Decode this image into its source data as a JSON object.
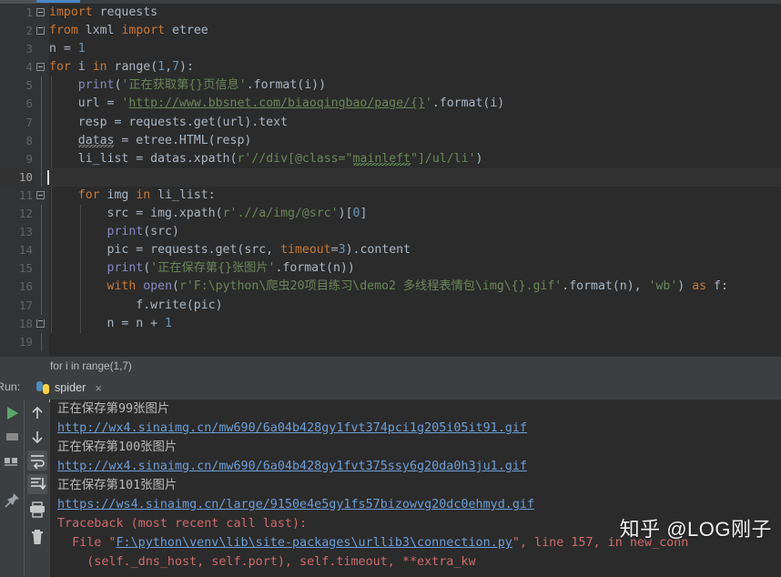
{
  "window": {
    "theme_bg": "#2b2b2b",
    "panel_bg": "#3c3f41",
    "accent": "#4a88c7"
  },
  "editor": {
    "current_line": 10,
    "lines": [
      {
        "n": "1",
        "text": "import requests"
      },
      {
        "n": "2",
        "text": "from lxml import etree"
      },
      {
        "n": "3",
        "text": "n = 1"
      },
      {
        "n": "4",
        "text": "for i in range(1,7):"
      },
      {
        "n": "5",
        "text": "    print('正在获取第{}页信息'.format(i))"
      },
      {
        "n": "6",
        "text": "    url = 'http://www.bbsnet.com/biaoqingbao/page/{}'.format(i)"
      },
      {
        "n": "7",
        "text": "    resp = requests.get(url).text"
      },
      {
        "n": "8",
        "text": "    datas = etree.HTML(resp)"
      },
      {
        "n": "9",
        "text": "    li_list = datas.xpath(r'//div[@class=\"mainleft\"]/ul/li')"
      },
      {
        "n": "10",
        "text": ""
      },
      {
        "n": "11",
        "text": "    for img in li_list:"
      },
      {
        "n": "12",
        "text": "        src = img.xpath(r'.//a/img/@src')[0]"
      },
      {
        "n": "13",
        "text": "        print(src)"
      },
      {
        "n": "14",
        "text": "        pic = requests.get(src, timeout=3).content"
      },
      {
        "n": "15",
        "text": "        print('正在保存第{}张图片'.format(n))"
      },
      {
        "n": "16",
        "text": "        with open(r'F:\\python\\爬虫20项目练习\\demo2 多线程表情包\\img\\{}.gif'.format(n), 'wb') as f:"
      },
      {
        "n": "17",
        "text": "            f.write(pic)"
      },
      {
        "n": "18",
        "text": "        n = n + 1"
      },
      {
        "n": "19",
        "text": ""
      }
    ],
    "gutter_numbers": [
      "1",
      "2",
      "3",
      "4",
      "5",
      "6",
      "7",
      "8",
      "9",
      "10",
      "11",
      "12",
      "13",
      "14",
      "15",
      "16",
      "17",
      "18",
      "19"
    ]
  },
  "breadcrumb": {
    "text": "for i in range(1,7)"
  },
  "run": {
    "label": "Run:",
    "tab_name": "spider",
    "tab_close": "×",
    "sidebar_icons": [
      "run-icon",
      "stop-icon",
      "layout-icon",
      "pin-icon"
    ],
    "toolbar_icons": [
      "arrow-up-icon",
      "arrow-down-icon",
      "soft-wrap-icon",
      "scroll-to-end-icon",
      "print-icon",
      "trash-icon"
    ],
    "console_lines": [
      {
        "type": "text",
        "text": "正在保存第99张图片"
      },
      {
        "type": "link",
        "text": "http://wx4.sinaimg.cn/mw690/6a04b428gy1fvt374pci1g205i05it91.gif"
      },
      {
        "type": "text",
        "text": "正在保存第100张图片"
      },
      {
        "type": "link",
        "text": "http://wx4.sinaimg.cn/mw690/6a04b428gy1fvt375ssy6g20da0h3ju1.gif"
      },
      {
        "type": "text",
        "text": "正在保存第101张图片"
      },
      {
        "type": "link",
        "text": "https://ws4.sinaimg.cn/large/9150e4e5gy1fs57bizowvg20dc0ehmyd.gif"
      },
      {
        "type": "error",
        "text": "Traceback (most recent call last):"
      },
      {
        "type": "error_file",
        "prefix": "  File \"",
        "path": "F:\\python\\venv\\lib\\site-packages\\urllib3\\connection.py",
        "suffix": "\", line 157, in new_conn"
      },
      {
        "type": "error",
        "text": "    (self._dns_host, self.port), self.timeout, **extra_kw"
      }
    ]
  },
  "watermark": {
    "text": "知乎 @LOG刚子"
  }
}
